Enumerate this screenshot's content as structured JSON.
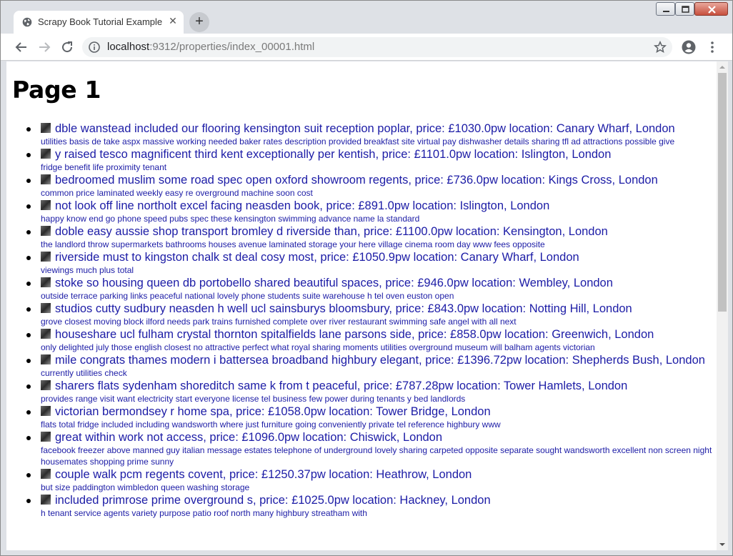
{
  "tab": {
    "title": "Scrapy Book Tutorial Example",
    "close": "✕",
    "new_tab": "+"
  },
  "address": {
    "host": "localhost",
    "rest": ":9312/properties/index_00001.html"
  },
  "page": {
    "heading": "Page 1"
  },
  "listings": [
    {
      "title": "dble wanstead included our flooring kensington suit reception poplar, price: £1030.0pw location: Canary Wharf, London",
      "desc": "utilities basis de take aspx massive working needed baker rates description provided breakfast site virtual pay dishwasher details sharing tfl ad attractions possible give"
    },
    {
      "title": "y raised tesco magnificent third kent exceptionally per kentish, price: £1101.0pw location: Islington, London",
      "desc": "fridge benefit life proximity tenant"
    },
    {
      "title": "bedroomed muslim some road spec open oxford showroom regents, price: £736.0pw location: Kings Cross, London",
      "desc": "common price laminated weekly easy re overground machine soon cost"
    },
    {
      "title": "not look off line northolt excel facing neasden book, price: £891.0pw location: Islington, London",
      "desc": "happy know end go phone speed pubs spec these kensington swimming advance name la standard"
    },
    {
      "title": "doble easy aussie shop transport bromley d riverside than, price: £1100.0pw location: Kensington, London",
      "desc": "the landlord throw supermarkets bathrooms houses avenue laminated storage your here village cinema room day www fees opposite"
    },
    {
      "title": "riverside must to kingston chalk st deal cosy most, price: £1050.9pw location: Canary Wharf, London",
      "desc": "viewings much plus total"
    },
    {
      "title": "stoke so housing queen db portobello shared beautiful spaces, price: £946.0pw location: Wembley, London",
      "desc": "outside terrace parking links peaceful national lovely phone students suite warehouse h tel oven euston open"
    },
    {
      "title": "studios cutty sudbury neasden h well ucl sainsburys bloomsbury, price: £843.0pw location: Notting Hill, London",
      "desc": "grove closest moving block ilford needs park trains furnished complete over river restaurant swimming safe angel with all next"
    },
    {
      "title": "houseshare ucl fulham crystal thornton spitalfields lane parsons side, price: £858.0pw location: Greenwich, London",
      "desc": "only delighted july those english closest no attractive perfect what royal sharing moments utilities overground museum will balham agents victorian"
    },
    {
      "title": "mile congrats thames modern i battersea broadband highbury elegant, price: £1396.72pw location: Shepherds Bush, London",
      "desc": "currently utilities check"
    },
    {
      "title": "sharers flats sydenham shoreditch same k from t peaceful, price: £787.28pw location: Tower Hamlets, London",
      "desc": "provides range visit want electricity start everyone license tel business few power during tenants y bed landlords"
    },
    {
      "title": "victorian bermondsey r home spa, price: £1058.0pw location: Tower Bridge, London",
      "desc": "flats total fridge included including wandsworth where just furniture going conveniently private tel reference highbury www"
    },
    {
      "title": "great within work not access, price: £1096.0pw location: Chiswick, London",
      "desc": "facebook freezer above manned guy italian message estates telephone of underground lovely sharing carpeted opposite separate sought wandsworth excellent non screen night housemates shopping prime sunny"
    },
    {
      "title": "couple walk pcm regents covent, price: £1250.37pw location: Heathrow, London",
      "desc": "but size paddington wimbledon queen washing storage"
    },
    {
      "title": "included primrose prime overground s, price: £1025.0pw location: Hackney, London",
      "desc": "h tenant service agents variety purpose patio roof north many highbury streatham with"
    }
  ]
}
